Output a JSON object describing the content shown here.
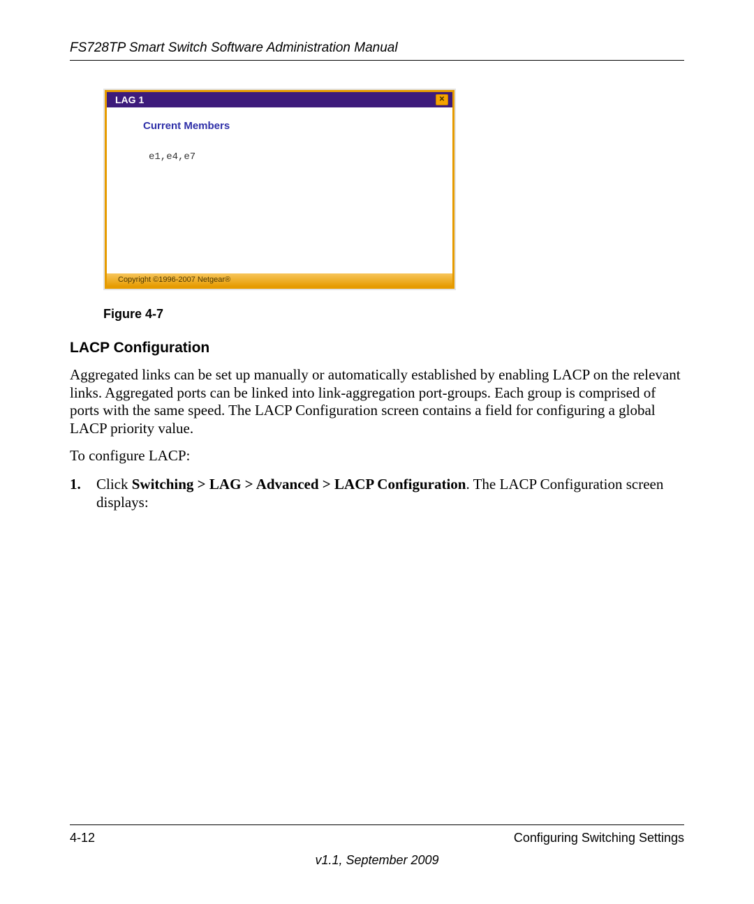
{
  "header": {
    "title": "FS728TP Smart Switch Software Administration Manual"
  },
  "dialog": {
    "title": "LAG 1",
    "section_label": "Current Members",
    "members": "e1,e4,e7",
    "copyright": "Copyright ©1996-2007 Netgear®",
    "close_glyph": "✕"
  },
  "figure": {
    "caption": "Figure 4-7"
  },
  "section": {
    "title": "LACP Configuration",
    "p1": "Aggregated links can be set up manually or automatically established by enabling LACP on the relevant links. Aggregated ports can be linked into link-aggregation port-groups. Each group is comprised of ports with the same speed. The LACP Configuration screen contains a field for configuring a global LACP priority value.",
    "p2": "To configure LACP:",
    "step1_prefix": "Click ",
    "step1_bold": "Switching > LAG > Advanced > LACP Configuration",
    "step1_suffix": ". The LACP Configuration screen displays:"
  },
  "footer": {
    "page": "4-12",
    "section": "Configuring Switching Settings",
    "version": "v1.1, September 2009"
  }
}
